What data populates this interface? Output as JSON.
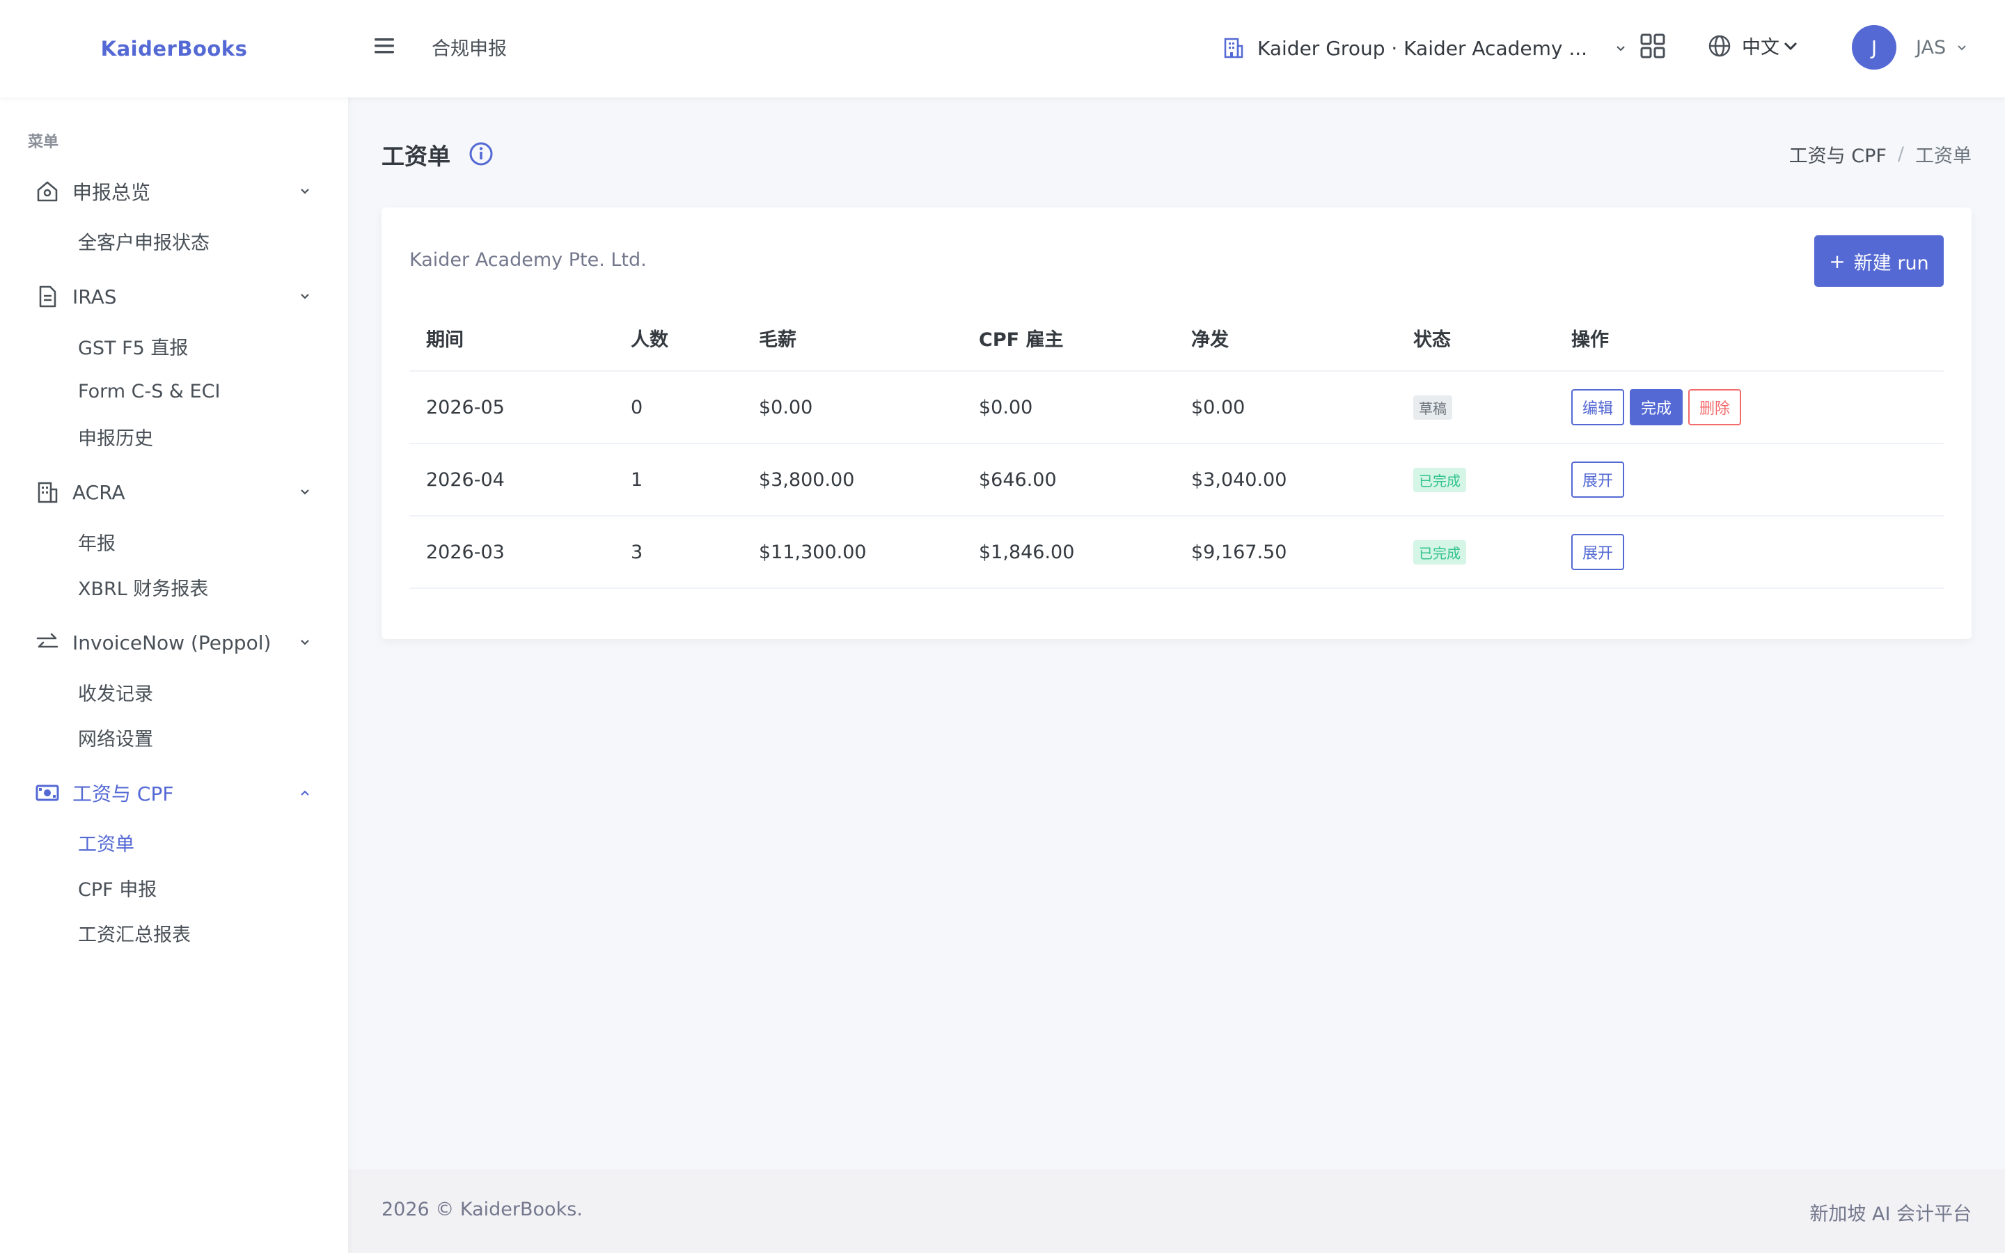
{
  "brand": "KaiderBooks",
  "topbar": {
    "section_title": "合规申报",
    "org": "Kaider Group · Kaider Academy ...",
    "language": "中文",
    "user_initial": "J",
    "user_name": "JAS"
  },
  "sidebar": {
    "menu_title": "菜单",
    "groups": [
      {
        "label": "申报总览",
        "icon": "home-icon",
        "children": [
          "全客户申报状态"
        ]
      },
      {
        "label": "IRAS",
        "icon": "document-icon",
        "children": [
          "GST F5 直报",
          "Form C-S & ECI",
          "申报历史"
        ]
      },
      {
        "label": "ACRA",
        "icon": "building-icon",
        "children": [
          "年报",
          "XBRL 财务报表"
        ]
      },
      {
        "label": "InvoiceNow (Peppol)",
        "icon": "transfer-icon",
        "children": [
          "收发记录",
          "网络设置"
        ]
      },
      {
        "label": "工资与 CPF",
        "icon": "money-icon",
        "children": [
          "工资单",
          "CPF 申报",
          "工资汇总报表"
        ]
      }
    ]
  },
  "page": {
    "title": "工资单",
    "breadcrumb": [
      "工资与 CPF",
      "工资单"
    ],
    "breadcrumb_sep": "/"
  },
  "card": {
    "company": "Kaider Academy Pte. Ltd.",
    "new_button": "新建 run",
    "new_button_icon": "+",
    "columns": [
      "期间",
      "人数",
      "毛薪",
      "CPF 雇主",
      "净发",
      "状态",
      "操作"
    ],
    "rows": [
      {
        "period": "2026-05",
        "headcount": "0",
        "gross": "$0.00",
        "cpf": "$0.00",
        "net": "$0.00",
        "status": "草稿",
        "actions": [
          "编辑",
          "完成",
          "删除"
        ]
      },
      {
        "period": "2026-04",
        "headcount": "1",
        "gross": "$3,800.00",
        "cpf": "$646.00",
        "net": "$3,040.00",
        "status": "已完成",
        "actions": [
          "展开"
        ]
      },
      {
        "period": "2026-03",
        "headcount": "3",
        "gross": "$11,300.00",
        "cpf": "$1,846.00",
        "net": "$9,167.50",
        "status": "已完成",
        "actions": [
          "展开"
        ]
      }
    ]
  },
  "footer": {
    "left": "2026 © KaiderBooks.",
    "right": "新加坡 AI 会计平台"
  },
  "colors": {
    "accent": "#5469d4",
    "success": "#34c38f",
    "danger": "#f46a6a"
  }
}
